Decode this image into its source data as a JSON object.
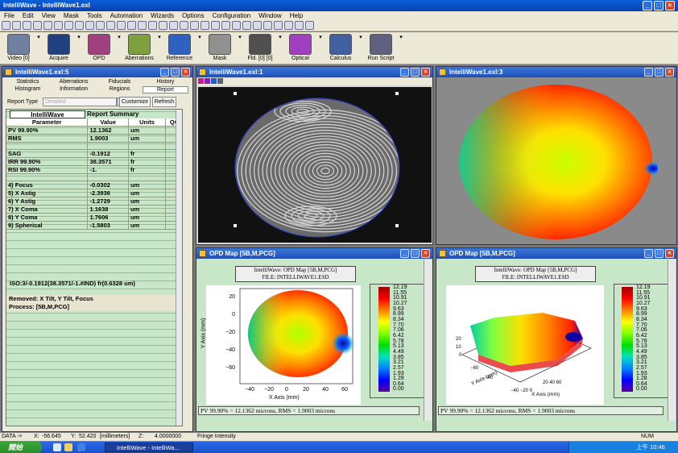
{
  "app": {
    "title": "IntelliWave - IntelliWave1.exl"
  },
  "menu": [
    "File",
    "Edit",
    "View",
    "Mask",
    "Tools",
    "Automation",
    "Wizards",
    "Options",
    "Configuration",
    "Window",
    "Help"
  ],
  "toolbar_big": [
    {
      "label": "Video [0]",
      "icon": "video-icon"
    },
    {
      "label": "Acquire",
      "icon": "camera-icon"
    },
    {
      "label": "OPD",
      "icon": "opd-icon"
    },
    {
      "label": "Aberrations",
      "icon": "aberrations-icon"
    },
    {
      "label": "Reference",
      "icon": "reference-icon"
    },
    {
      "label": "Mask",
      "icon": "mask-icon"
    },
    {
      "label": "Fld. [0] [0]",
      "icon": "field-icon"
    },
    {
      "label": "Optical",
      "icon": "optical-icon"
    },
    {
      "label": "Calculus",
      "icon": "calculus-icon"
    },
    {
      "label": "Run Script",
      "icon": "script-icon"
    }
  ],
  "report": {
    "title": "IntelliWave1.exl:5",
    "tabs_row1": [
      "Statistics",
      "Aberrations",
      "Fiducials",
      "History"
    ],
    "tabs_row2": [
      "Histogram",
      "Information",
      "Regions",
      "Report"
    ],
    "report_type_label": "Report Type",
    "report_type_value": "Detailed",
    "customize": "Customize",
    "refresh": "Refresh",
    "logo": "IntelliWave",
    "summary": "Report Summary",
    "headers": [
      "Parameter",
      "Value",
      "Units",
      "QC"
    ],
    "rows": [
      [
        "PV 99.90%",
        "12.1362",
        "um",
        ""
      ],
      [
        "RMS",
        "1.9003",
        "um",
        ""
      ],
      [
        "",
        "",
        "",
        ""
      ],
      [
        "SAG",
        "-0.1912",
        "fr",
        ""
      ],
      [
        "IRR 99.90%",
        "38.3571",
        "fr",
        ""
      ],
      [
        "RSI 99.90%",
        "-1.",
        "fr",
        ""
      ],
      [
        "",
        "",
        "",
        ""
      ],
      [
        " 4) Focus",
        "-0.0302",
        "um",
        ""
      ],
      [
        " 5) X Astig",
        "-2.3936",
        "um",
        ""
      ],
      [
        " 6) Y Astig",
        "-1.2729",
        "um",
        ""
      ],
      [
        " 7) X Coma",
        "1.1638",
        "um",
        ""
      ],
      [
        " 8) Y Coma",
        "1.7606",
        "um",
        ""
      ],
      [
        " 9) Spherical",
        "-1.5803",
        "um",
        ""
      ]
    ],
    "iso": "ISO:3/-0.1912(38.3571/-1.#IND) fr(0.6328 um)",
    "removed": "Removed: X Tilt, Y Tilt, Focus",
    "process": "Process: [5B,M,PCG]"
  },
  "win_fringe": {
    "title": "IntelliWave1.exl:1"
  },
  "win_3d": {
    "title": "IntelliWave1.exl:3"
  },
  "win_opd1": {
    "title": "OPD Map [5B,M,PCG]",
    "header1": "IntelliWave: OPD Map [5B,M,PCG]",
    "header2": "FILE: INTELLIWAVE1.ESD",
    "footer": "PV 99.90% =   12.1362 microns, RMS =   1.9003 microns",
    "ylabel": "Y Axis   (mm)",
    "xlabel": "X Axis   (mm)"
  },
  "win_opd2": {
    "title": "OPD Map [5B,M,PCG]",
    "header1": "IntelliWave: OPD Map [5B,M,PCG]",
    "header2": "FILE: INTELLIWAVE1.ESD",
    "footer": "PV 99.90% =   12.1362 microns, RMS =   1.9003 microns",
    "xlabel": "X Axis   (mm)",
    "ylabel": "Y Axis   (mm)"
  },
  "colorbar": [
    "12.19",
    "11.55",
    "10.91",
    "10.27",
    "9.63",
    "8.99",
    "8.34",
    "7.70",
    "7.06",
    "6.42",
    "5.78",
    "5.13",
    "4.49",
    "3.85",
    "3.21",
    "2.57",
    "1.93",
    "1.28",
    "0.64",
    "0.00"
  ],
  "status": {
    "mode": "DATA ->",
    "x_label": "X:",
    "x_val": "-56.645",
    "y_label": "Y:",
    "y_val": "52.420",
    "units": "[millimeters]",
    "z_label": "Z:",
    "z_val": "4.0000000",
    "info": "Fringe Intensity",
    "num": "NUM"
  },
  "taskbar": {
    "start": "開始",
    "task": "IntelliWave - IntelliWa...",
    "time": "上午 10:46"
  }
}
